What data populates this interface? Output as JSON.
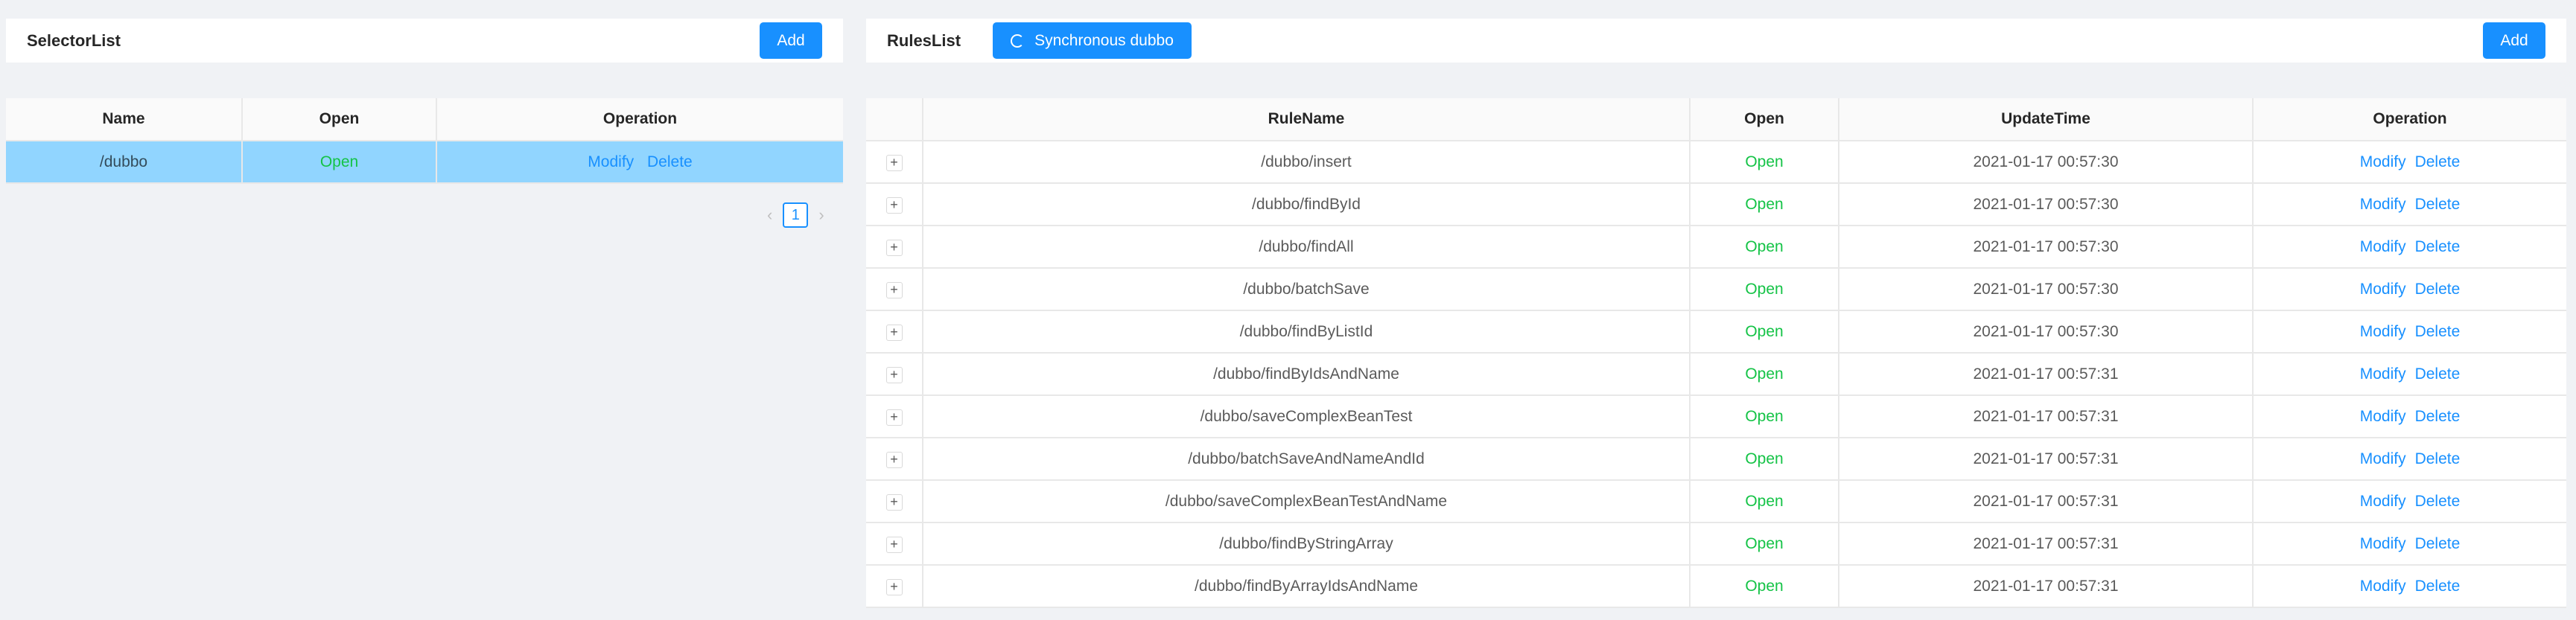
{
  "selector": {
    "title": "SelectorList",
    "add_label": "Add",
    "columns": [
      "Name",
      "Open",
      "Operation"
    ],
    "rows": [
      {
        "name": "/dubbo",
        "open": "Open",
        "modify": "Modify",
        "delete": "Delete"
      }
    ],
    "pagination": {
      "current": "1"
    }
  },
  "rules": {
    "title": "RulesList",
    "sync_label": "Synchronous dubbo",
    "add_label": "Add",
    "columns": [
      "RuleName",
      "Open",
      "UpdateTime",
      "Operation"
    ],
    "expand_label": "+",
    "rows": [
      {
        "name": "/dubbo/insert",
        "open": "Open",
        "time": "2021-01-17 00:57:30",
        "modify": "Modify",
        "delete": "Delete"
      },
      {
        "name": "/dubbo/findById",
        "open": "Open",
        "time": "2021-01-17 00:57:30",
        "modify": "Modify",
        "delete": "Delete"
      },
      {
        "name": "/dubbo/findAll",
        "open": "Open",
        "time": "2021-01-17 00:57:30",
        "modify": "Modify",
        "delete": "Delete"
      },
      {
        "name": "/dubbo/batchSave",
        "open": "Open",
        "time": "2021-01-17 00:57:30",
        "modify": "Modify",
        "delete": "Delete"
      },
      {
        "name": "/dubbo/findByListId",
        "open": "Open",
        "time": "2021-01-17 00:57:30",
        "modify": "Modify",
        "delete": "Delete"
      },
      {
        "name": "/dubbo/findByIdsAndName",
        "open": "Open",
        "time": "2021-01-17 00:57:31",
        "modify": "Modify",
        "delete": "Delete"
      },
      {
        "name": "/dubbo/saveComplexBeanTest",
        "open": "Open",
        "time": "2021-01-17 00:57:31",
        "modify": "Modify",
        "delete": "Delete"
      },
      {
        "name": "/dubbo/batchSaveAndNameAndId",
        "open": "Open",
        "time": "2021-01-17 00:57:31",
        "modify": "Modify",
        "delete": "Delete"
      },
      {
        "name": "/dubbo/saveComplexBeanTestAndName",
        "open": "Open",
        "time": "2021-01-17 00:57:31",
        "modify": "Modify",
        "delete": "Delete"
      },
      {
        "name": "/dubbo/findByStringArray",
        "open": "Open",
        "time": "2021-01-17 00:57:31",
        "modify": "Modify",
        "delete": "Delete"
      },
      {
        "name": "/dubbo/findByArrayIdsAndName",
        "open": "Open",
        "time": "2021-01-17 00:57:31",
        "modify": "Modify",
        "delete": "Delete"
      }
    ]
  },
  "colors": {
    "primary": "#1890ff",
    "open_status": "#14c346",
    "selected_row": "#91d5ff",
    "background": "#f0f2f5"
  }
}
